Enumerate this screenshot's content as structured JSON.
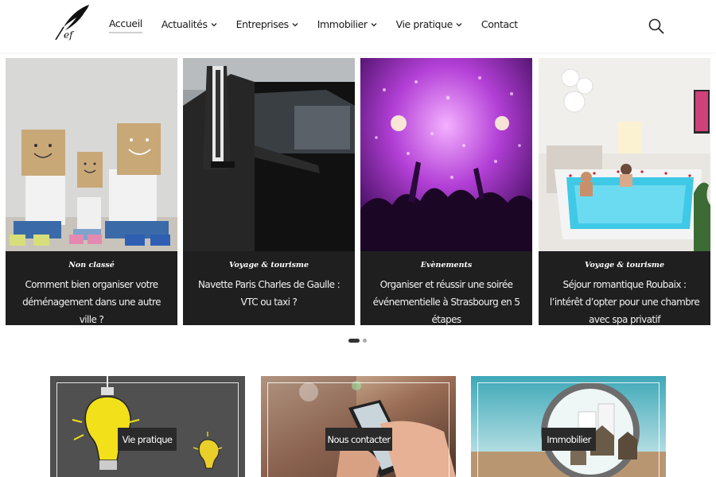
{
  "header": {
    "nav": [
      {
        "label": "Accueil",
        "dropdown": false,
        "active": true
      },
      {
        "label": "Actualités",
        "dropdown": true
      },
      {
        "label": "Entreprises",
        "dropdown": true
      },
      {
        "label": "Immobilier",
        "dropdown": true
      },
      {
        "label": "Vie pratique",
        "dropdown": true
      },
      {
        "label": "Contact",
        "dropdown": false
      }
    ],
    "search_icon": "search-icon",
    "logo_icon": "quill-logo"
  },
  "slider": {
    "cards": [
      {
        "category": "Non classé",
        "title": "Comment bien organiser votre déménagement dans une autre ville ?"
      },
      {
        "category": "Voyage & tourisme",
        "title": "Navette Paris Charles de Gaulle : VTC ou taxi ?"
      },
      {
        "category": "Evènements",
        "title": "Organiser et réussir une soirée événementielle à Strasbourg en 5 étapes"
      },
      {
        "category": "Voyage & tourisme",
        "title": "Séjour romantique Roubaix : l’intérêt d’opter pour une chambre avec spa privatif"
      }
    ],
    "pages": 2,
    "current_page": 1
  },
  "tiles": [
    {
      "label": "Vie pratique"
    },
    {
      "label": "Nous contacter"
    },
    {
      "label": "Immobilier"
    }
  ],
  "colors": {
    "caption_bg": "#1f1f1f",
    "tile_label_bg": "#2a2a2a",
    "active_underline": "#cfcfcf"
  }
}
